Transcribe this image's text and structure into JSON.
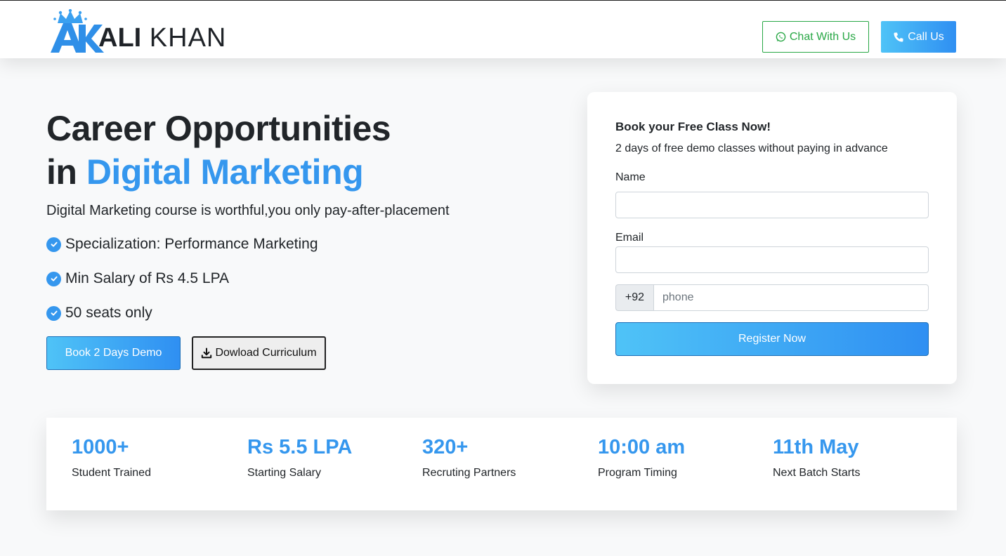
{
  "brand": {
    "name_bold": "ALI",
    "name_regular": "KHAN",
    "logo_mark": "AK",
    "logo_icon": "crown-icon",
    "accent_color": "#3597ee"
  },
  "header": {
    "chat_label": "Chat With Us",
    "chat_icon": "whatsapp-icon",
    "call_label": "Call Us",
    "call_icon": "phone-icon"
  },
  "hero": {
    "title_line1": "Career Opportunities",
    "title_line2_prefix": "in ",
    "title_line2_accent": "Digital Marketing",
    "subtitle": "Digital Marketing course is worthful,you only pay-after-placement",
    "bullets": [
      "Specialization: Performance Marketing",
      "Min Salary of Rs 4.5 LPA",
      "50 seats only"
    ],
    "demo_button": "Book 2 Days Demo",
    "curriculum_button": "Dowload Curriculum",
    "curriculum_icon": "download-icon"
  },
  "form": {
    "title": "Book your Free Class Now!",
    "description": "2 days of free demo classes without paying in advance",
    "name_label": "Name",
    "name_value": "",
    "email_label": "Email",
    "email_value": "",
    "phone_prefix": "+92",
    "phone_placeholder": "phone",
    "phone_value": "",
    "submit_label": "Register Now"
  },
  "stats": [
    {
      "value": "1000+",
      "caption": "Student Trained"
    },
    {
      "value": "Rs 5.5 LPA",
      "caption": "Starting Salary"
    },
    {
      "value": "320+",
      "caption": "Recruting Partners"
    },
    {
      "value": "10:00 am",
      "caption": "Program Timing"
    },
    {
      "value": "11th May",
      "caption": "Next Batch Starts"
    }
  ]
}
